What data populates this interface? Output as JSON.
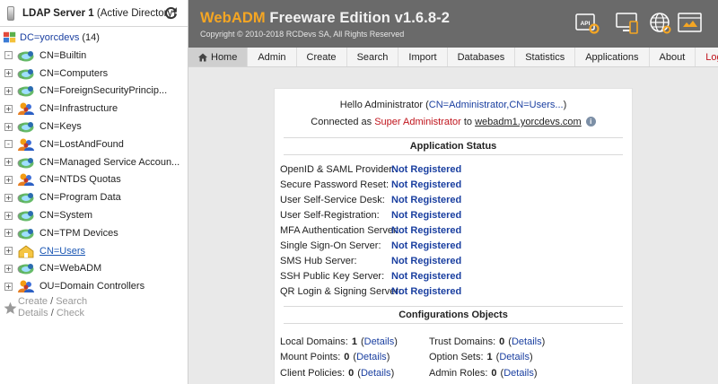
{
  "left_panel": {
    "server_name": "LDAP Server 1",
    "server_type": "(Active Directory)",
    "root": {
      "label": "DC=yorcdevs",
      "count": "(14)"
    },
    "nodes": [
      {
        "label": "CN=Builtin",
        "pm": "-",
        "icon": "container-icon",
        "link": false
      },
      {
        "label": "CN=Computers",
        "pm": "+",
        "icon": "container-icon",
        "link": false
      },
      {
        "label": "CN=ForeignSecurityPrincip...",
        "pm": "+",
        "icon": "container-icon",
        "link": false
      },
      {
        "label": "CN=Infrastructure",
        "pm": "+",
        "icon": "group-icon",
        "link": false
      },
      {
        "label": "CN=Keys",
        "pm": "+",
        "icon": "container-icon",
        "link": false
      },
      {
        "label": "CN=LostAndFound",
        "pm": "-",
        "icon": "group-icon",
        "link": false
      },
      {
        "label": "CN=Managed Service Accoun...",
        "pm": "+",
        "icon": "container-icon",
        "link": false
      },
      {
        "label": "CN=NTDS Quotas",
        "pm": "+",
        "icon": "group-icon",
        "link": false
      },
      {
        "label": "CN=Program Data",
        "pm": "+",
        "icon": "container-icon",
        "link": false
      },
      {
        "label": "CN=System",
        "pm": "+",
        "icon": "container-icon",
        "link": false
      },
      {
        "label": "CN=TPM Devices",
        "pm": "+",
        "icon": "container-icon",
        "link": false
      },
      {
        "label": "CN=Users",
        "pm": "+",
        "icon": "home-folder-icon",
        "link": true
      },
      {
        "label": "CN=WebADM",
        "pm": "+",
        "icon": "container-icon",
        "link": false
      },
      {
        "label": "OU=Domain Controllers",
        "pm": "+",
        "icon": "group-icon",
        "link": false
      }
    ],
    "actions": {
      "create": "Create",
      "search": "Search",
      "details": "Details",
      "check": "Check",
      "sep": "/"
    }
  },
  "header": {
    "title_brand": "WebADM",
    "title_rest": " Freeware Edition v1.6.8-2",
    "copyright": "Copyright © 2010-2018 RCDevs SA, All Rights Reserved",
    "icons": [
      "api-settings-icon",
      "devices-icon",
      "globe-icon",
      "web-server-icon"
    ],
    "accent_color": "#f5a623"
  },
  "nav": {
    "items": [
      "Home",
      "Admin",
      "Create",
      "Search",
      "Import",
      "Databases",
      "Statistics",
      "Applications",
      "About",
      "Logout"
    ],
    "active": "Home",
    "logout_color": "#c0141c"
  },
  "content": {
    "hello_prefix": "Hello Administrator (",
    "hello_dn": "CN=Administrator,CN=Users...",
    "hello_suffix": ")",
    "connected_prefix": "Connected as ",
    "connected_role": "Super Administrator",
    "connected_mid": " to ",
    "connected_host": "webadm1.yorcdevs.com",
    "info_glyph": "i",
    "app_status_title": "Application Status",
    "app_status": [
      {
        "label": "OpenID & SAML Provider:",
        "value": "Not Registered"
      },
      {
        "label": "Secure Password Reset:",
        "value": "Not Registered"
      },
      {
        "label": "User Self-Service Desk:",
        "value": "Not Registered"
      },
      {
        "label": "User Self-Registration:",
        "value": "Not Registered"
      },
      {
        "label": "MFA Authentication Server:",
        "value": "Not Registered"
      },
      {
        "label": "Single Sign-On Server:",
        "value": "Not Registered"
      },
      {
        "label": "SMS Hub Server:",
        "value": "Not Registered"
      },
      {
        "label": "SSH Public Key Server:",
        "value": "Not Registered"
      },
      {
        "label": "QR Login & Signing Server:",
        "value": "Not Registered"
      }
    ],
    "config_title": "Configurations Objects",
    "config_rows": [
      [
        {
          "label": "Local Domains:",
          "count": "1",
          "details": "Details"
        },
        {
          "label": "Trust Domains:",
          "count": "0",
          "details": "Details"
        }
      ],
      [
        {
          "label": "Mount Points:",
          "count": "0",
          "details": "Details"
        },
        {
          "label": "Option Sets:",
          "count": "1",
          "details": "Details"
        }
      ],
      [
        {
          "label": "Client Policies:",
          "count": "0",
          "details": "Details"
        },
        {
          "label": "Admin Roles:",
          "count": "0",
          "details": "Details"
        }
      ]
    ]
  }
}
